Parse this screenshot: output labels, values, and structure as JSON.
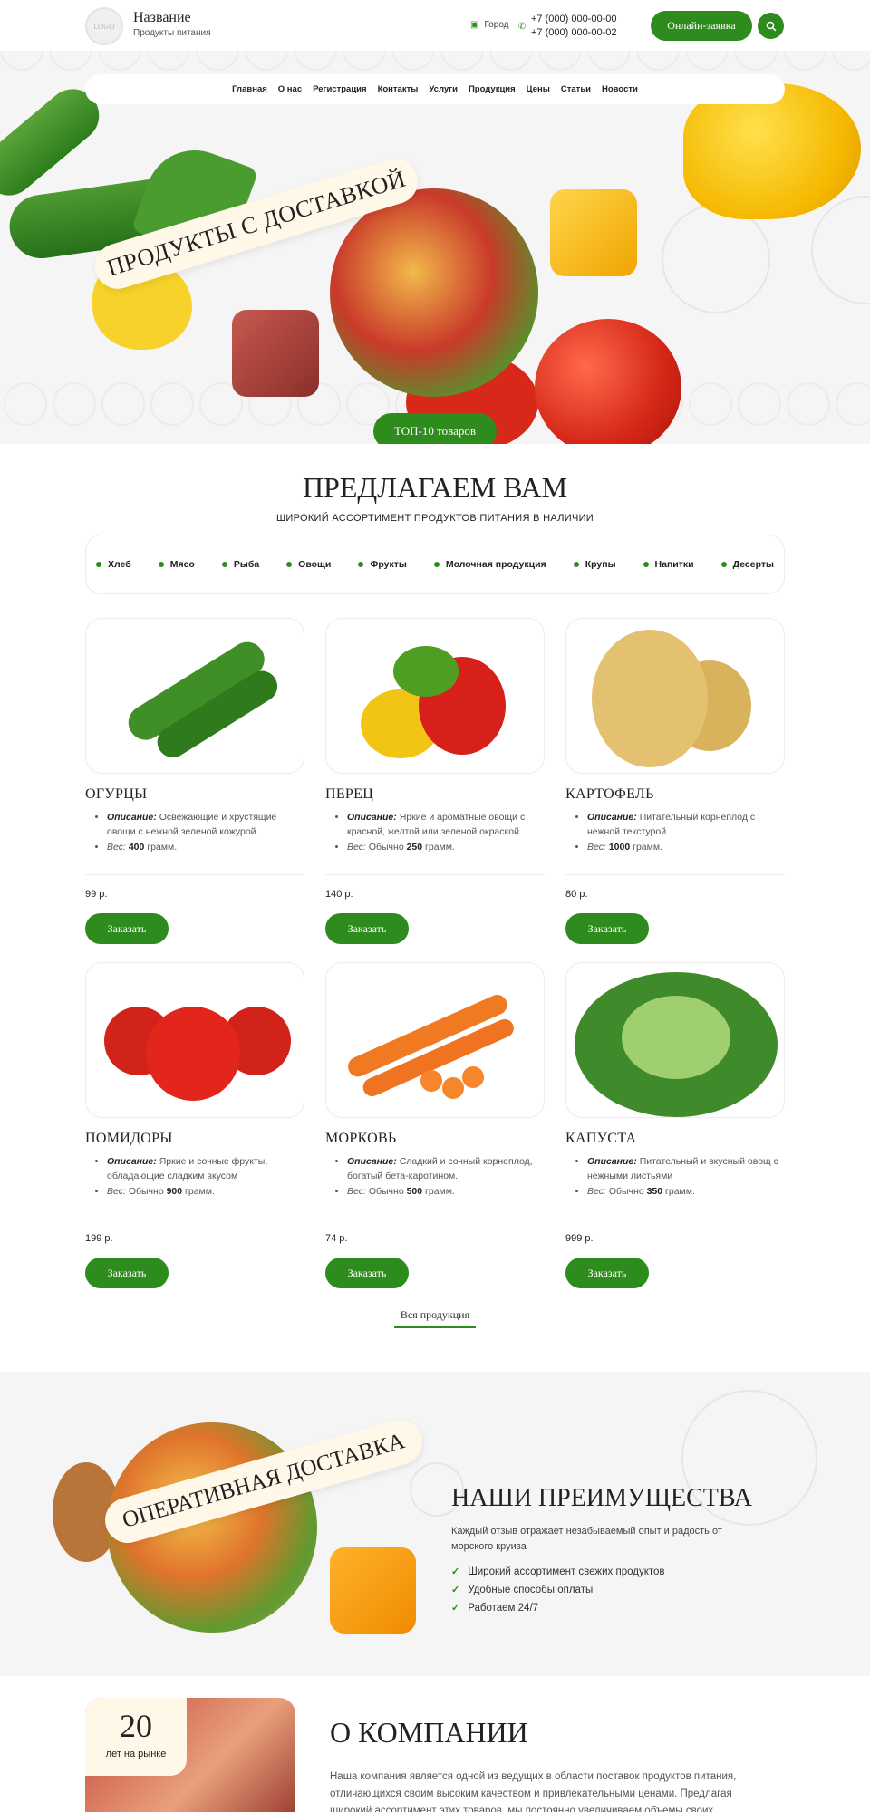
{
  "header": {
    "logo_text": "LOGO",
    "brand_name": "Название",
    "brand_sub": "Продукты питания",
    "city": "Город",
    "phone_1": "+7 (000) 000-00-00",
    "phone_2": "+7 (000) 000-00-02",
    "cta_label": "Онлайн-заявка"
  },
  "nav": {
    "items": [
      "Главная",
      "О нас",
      "Регистрация",
      "Контакты",
      "Услуги",
      "Продукция",
      "Цены",
      "Статьи",
      "Новости"
    ]
  },
  "hero": {
    "title": "ПРОДУКТЫ С ДОСТАВКОЙ",
    "button_label": "ТОП-10 товаров"
  },
  "offer": {
    "title": "ПРЕДЛАГАЕМ ВАМ",
    "subtitle": "ШИРОКИЙ АССОРТИМЕНТ ПРОДУКТОВ ПИТАНИЯ В НАЛИЧИИ",
    "categories": [
      "Хлеб",
      "Мясо",
      "Рыба",
      "Овощи",
      "Фрукты",
      "Молочная продукция",
      "Крупы",
      "Напитки",
      "Десерты"
    ]
  },
  "labels": {
    "desc_key": "Описание:",
    "weight_key": "Вес:",
    "gram": "грамм.",
    "order": "Заказать"
  },
  "products": [
    {
      "name": "ОГУРЦЫ",
      "desc": "Освежающие и хрустящие овощи с нежной зеленой кожурой.",
      "weight_prefix": "",
      "weight": "400",
      "price": "99 р."
    },
    {
      "name": "ПЕРЕЦ",
      "desc": "Яркие и ароматные овощи с красной, желтой или зеленой окраской",
      "weight_prefix": "Обычно",
      "weight": "250",
      "price": "140 р."
    },
    {
      "name": "КАРТОФЕЛЬ",
      "desc": "Питательный корнеплод с нежной текстурой",
      "weight_prefix": "",
      "weight": "1000",
      "price": "80 р."
    },
    {
      "name": "ПОМИДОРЫ",
      "desc": "Яркие и сочные фрукты, обладающие сладким вкусом",
      "weight_prefix": "Обычно",
      "weight": "900",
      "price": "199 р."
    },
    {
      "name": "МОРКОВЬ",
      "desc": "Сладкий и сочный корнеплод, богатый бета-каротином.",
      "weight_prefix": "Обычно",
      "weight": "500",
      "price": "74 р."
    },
    {
      "name": "КАПУСТА",
      "desc": "Питательный и вкусный овощ с нежными листьями",
      "weight_prefix": "Обычно",
      "weight": "350",
      "price": "999 р."
    }
  ],
  "all_products_link": "Вся продукция",
  "advantages": {
    "band_text": "ОПЕРАТИВНАЯ ДОСТАВКА",
    "title": "НАШИ ПРЕИМУЩЕСТВА",
    "subtitle": "Каждый отзыв отражает незабываемый опыт и радость от морского круиза",
    "items": [
      "Широкий ассортимент свежих продуктов",
      "Удобные способы оплаты",
      "Работаем 24/7"
    ]
  },
  "about": {
    "years": "20",
    "years_label": "лет на рынке",
    "title": "О КОМПАНИИ",
    "text": "Наша компания является одной из ведущих в области поставок продуктов питания, отличающихся своим высоким качеством и привлекательными ценами. Предлагая широкий ассортимент этих товаров, мы постоянно увеличиваем объемы своих"
  },
  "colors": {
    "accent": "#2e8b1e",
    "band": "#fff8e9",
    "section_bg": "#f5f5f5"
  },
  "icons": {
    "city": "location-icon",
    "phone": "phone-icon",
    "search": "search-icon",
    "check": "check-icon"
  }
}
